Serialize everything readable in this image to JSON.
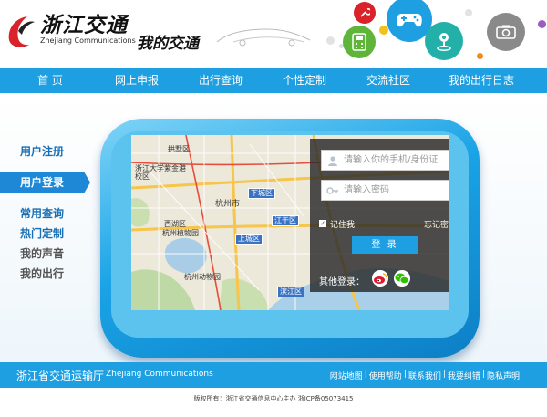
{
  "header": {
    "logo_cn": "浙江交通",
    "logo_en": "Zhejiang Communications",
    "tagline": "我的交通",
    "icons": [
      "wrench-icon",
      "gamepad-icon",
      "location-pin-icon",
      "camera-icon",
      "calculator-icon"
    ],
    "colors": {
      "red": "#d9222a",
      "blue": "#1e9fe2",
      "green": "#5fb53a",
      "teal": "#22b0a8",
      "gray": "#8a8a8a"
    }
  },
  "nav": {
    "items": [
      {
        "label": "首 页"
      },
      {
        "label": "网上申报"
      },
      {
        "label": "出行查询"
      },
      {
        "label": "个性定制"
      },
      {
        "label": "交流社区"
      },
      {
        "label": "我的出行日志"
      }
    ]
  },
  "sidebar": {
    "register": "用户注册",
    "login": "用户登录",
    "items": [
      {
        "label": "常用查询",
        "color": "#1a6fb3"
      },
      {
        "label": "热门定制",
        "color": "#1a6fb3"
      },
      {
        "label": "我的声音",
        "color": "#555555"
      },
      {
        "label": "我的出行",
        "color": "#555555"
      }
    ]
  },
  "map": {
    "labels": [
      "拱墅区",
      "浙江大学紫金港校区",
      "杭州市",
      "西湖区",
      "杭州植物园",
      "杭州动物园"
    ],
    "badges": [
      "下城区",
      "江干区",
      "上城区",
      "滨江区"
    ]
  },
  "login": {
    "phone_placeholder": "请输入你的手机/身份证",
    "password_placeholder": "请输入密码",
    "remember": "记住我",
    "forgot": "忘记密码？",
    "button": "登 录",
    "other": "其他登录："
  },
  "footer": {
    "org": "浙江省交通运输厅",
    "org_en": "Zhejiang Communications",
    "links": [
      "网站地图",
      "使用帮助",
      "联系我们",
      "我要纠错",
      "隐私声明"
    ],
    "copyright": "版权所有：浙江省交通信息中心主办  浙ICP备05073415"
  }
}
